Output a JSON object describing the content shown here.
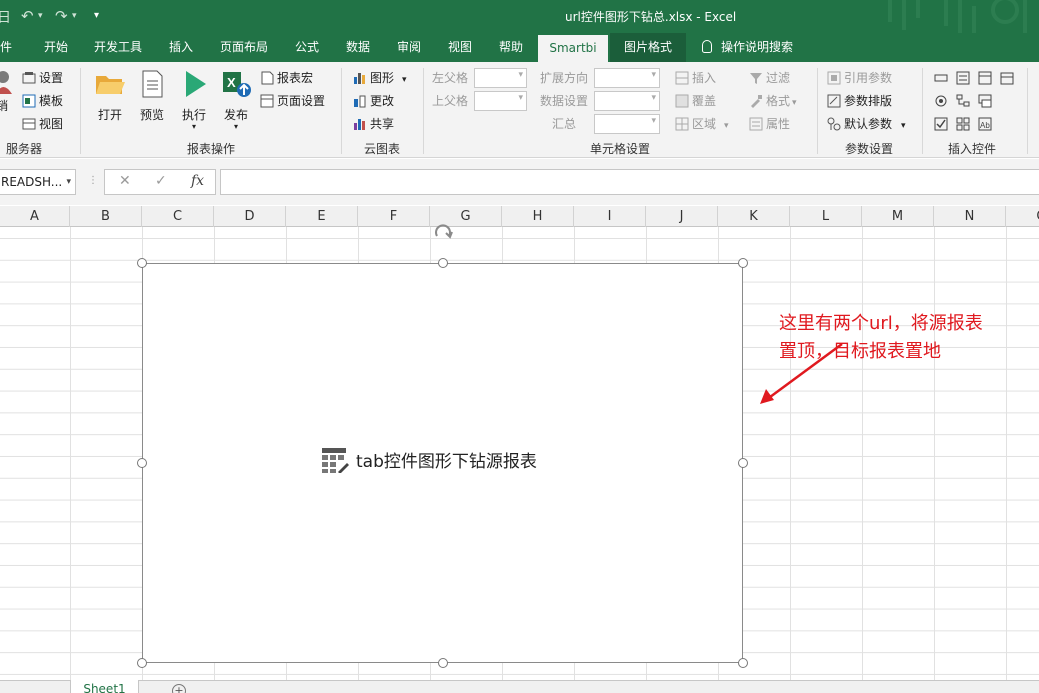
{
  "window": {
    "title": "url控件图形下钻总.xlsx  -  Excel",
    "quick_access": {
      "app_glyph": "日",
      "undo": "↶",
      "redo": "↷",
      "more": "▾"
    }
  },
  "menu": {
    "tabs": [
      {
        "label": "件"
      },
      {
        "label": "开始"
      },
      {
        "label": "开发工具"
      },
      {
        "label": "插入"
      },
      {
        "label": "页面布局"
      },
      {
        "label": "公式"
      },
      {
        "label": "数据"
      },
      {
        "label": "审阅"
      },
      {
        "label": "视图"
      },
      {
        "label": "帮助"
      },
      {
        "label": "Smartbi"
      },
      {
        "label": "图片格式"
      }
    ],
    "active_tab": "Smartbi",
    "tell_me": "操作说明搜索"
  },
  "ribbon": {
    "server": {
      "label": "服务器",
      "logout": "销",
      "items": [
        {
          "label": "设置"
        },
        {
          "label": "模板"
        },
        {
          "label": "视图"
        }
      ]
    },
    "report_ops": {
      "label": "报表操作",
      "big": [
        {
          "label": "打开"
        },
        {
          "label": "预览"
        },
        {
          "label": "执行"
        },
        {
          "label": "发布"
        }
      ],
      "small": [
        {
          "label": "报表宏"
        },
        {
          "label": "页面设置"
        }
      ]
    },
    "cloud_chart": {
      "label": "云图表",
      "items": [
        {
          "label": "图形"
        },
        {
          "label": "更改"
        },
        {
          "label": "共享"
        }
      ]
    },
    "cell_settings": {
      "label": "单元格设置",
      "fields": [
        {
          "label": "左父格"
        },
        {
          "label": "上父格"
        },
        {
          "label": "扩展方向"
        },
        {
          "label": "数据设置"
        },
        {
          "label": "汇总"
        }
      ],
      "actions": [
        {
          "label": "插入"
        },
        {
          "label": "覆盖"
        },
        {
          "label": "区域"
        },
        {
          "label": "过滤"
        },
        {
          "label": "格式"
        },
        {
          "label": "属性"
        }
      ]
    },
    "param_settings": {
      "label": "参数设置",
      "items": [
        {
          "label": "引用参数"
        },
        {
          "label": "参数排版"
        },
        {
          "label": "默认参数"
        }
      ]
    },
    "insert_controls": {
      "label": "插入控件"
    }
  },
  "formula_bar": {
    "name_box": "READSH...",
    "cancel_glyph": "✕",
    "enter_glyph": "✓",
    "fx_glyph": "fx",
    "formula": ""
  },
  "sheet": {
    "columns": [
      "A",
      "B",
      "C",
      "D",
      "E",
      "F",
      "G",
      "H",
      "I",
      "J",
      "K",
      "L",
      "M",
      "N",
      "O"
    ]
  },
  "chart_object": {
    "label": "tab控件图形下钻源报表"
  },
  "annotation": {
    "text": "这里有两个url，将源报表\n置顶，目标报表置地",
    "color": "#e0191f"
  },
  "sheet_tabs": {
    "tabs": [
      {
        "label": "Sheet1"
      }
    ],
    "add_glyph": "+"
  },
  "colors": {
    "excel_green": "#217346",
    "ribbon_bg": "#f3f3f3",
    "annotation_red": "#e0191f"
  }
}
